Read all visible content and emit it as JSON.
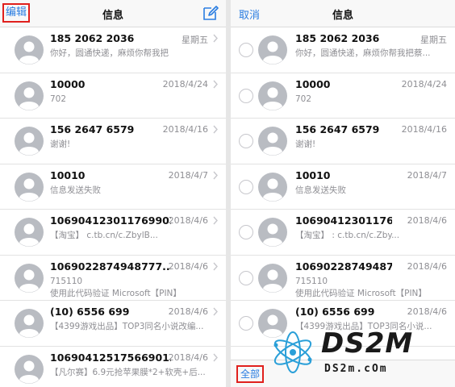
{
  "left_panel": {
    "nav_left": "编辑",
    "title": "信息",
    "messages": [
      {
        "sender": "185 2062 2036",
        "date": "星期五",
        "preview": [
          "你好，圆通快递，麻烦你帮我把"
        ]
      },
      {
        "sender": "10000",
        "date": "2018/4/24",
        "preview": [
          "702"
        ]
      },
      {
        "sender": "156 2647 6579",
        "date": "2018/4/16",
        "preview": [
          "谢谢!"
        ]
      },
      {
        "sender": "10010",
        "date": "2018/4/7",
        "preview": [
          "信息发送失败"
        ]
      },
      {
        "sender": "1069041230117699011...",
        "date": "2018/4/6",
        "preview": [
          "【淘宝】          c.tb.cn/c.ZbylB..."
        ]
      },
      {
        "sender": "1069022874948777...",
        "date": "2018/4/6",
        "preview": [
          "715110",
          "使用此代码验证 Microsoft【PIN】"
        ]
      },
      {
        "sender": "(10) 6556 699",
        "date": "2018/4/6",
        "preview": [
          "【4399游戏出品】TOP3同名小说改编..."
        ]
      },
      {
        "sender": "10690412517566901...",
        "date": "2018/4/6",
        "preview": [
          "【凡尔赛】6.9元抢苹果膜*2+软壳+后..."
        ]
      }
    ]
  },
  "right_panel": {
    "nav_left": "取消",
    "title": "信息",
    "select_all": "全部",
    "messages": [
      {
        "sender": "185 2062 2036",
        "date": "星期五",
        "preview": [
          "你好，圆通快递，麻烦你帮我把蔡..."
        ]
      },
      {
        "sender": "10000",
        "date": "2018/4/24",
        "preview": [
          "702"
        ]
      },
      {
        "sender": "156 2647 6579",
        "date": "2018/4/16",
        "preview": [
          "谢谢!"
        ]
      },
      {
        "sender": "10010",
        "date": "2018/4/7",
        "preview": [
          "信息发送失败"
        ]
      },
      {
        "sender": "106904123011769999...",
        "date": "2018/4/6",
        "preview": [
          "【淘宝】        :    c.tb.cn/c.Zby..."
        ]
      },
      {
        "sender": "1069022874948777...",
        "date": "2018/4/6",
        "preview": [
          "715110",
          "使用此代码验证 Microsoft【PIN】"
        ]
      },
      {
        "sender": "(10) 6556 699",
        "date": "2018/4/6",
        "preview": [
          "【4399游戏出品】TOP3同名小说..."
        ]
      }
    ]
  },
  "watermark": {
    "big": "DS2M",
    "small": "DS2m.cOm"
  },
  "colors": {
    "accent": "#2a7de1",
    "highlight": "#e0201d",
    "secondary_text": "#8e8e93"
  }
}
